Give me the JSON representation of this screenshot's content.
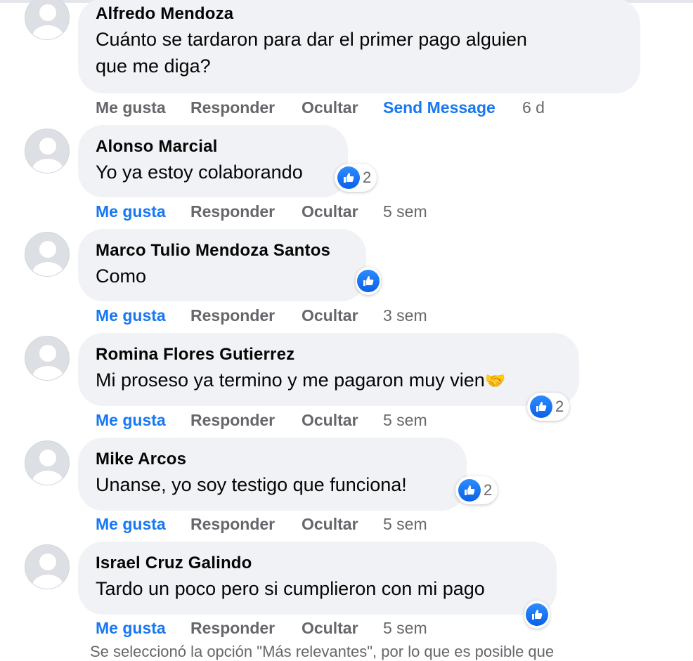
{
  "comments": [
    {
      "author": "Alfredo Mendoza",
      "text_line1": "Cuánto se tardaron para dar el primer pago alguien",
      "text_line2": "que me diga?",
      "actions": {
        "like": "Me gusta",
        "reply": "Responder",
        "hide": "Ocultar",
        "send": "Send Message",
        "time": "6 d"
      }
    },
    {
      "author": "Alonso Marcial",
      "text": "Yo ya estoy colaborando",
      "reactions": "2",
      "actions": {
        "like": "Me gusta",
        "reply": "Responder",
        "hide": "Ocultar",
        "time": "5 sem"
      }
    },
    {
      "author": "Marco Tulio Mendoza Santos",
      "text": "Como",
      "actions": {
        "like": "Me gusta",
        "reply": "Responder",
        "hide": "Ocultar",
        "time": "3 sem"
      }
    },
    {
      "author": "Romina Flores Gutierrez",
      "text": "Mi proseso ya termino y me pagaron muy vien",
      "emoji": "🤝",
      "reactions": "2",
      "actions": {
        "like": "Me gusta",
        "reply": "Responder",
        "hide": "Ocultar",
        "time": "5 sem"
      }
    },
    {
      "author": "Mike Arcos",
      "text": "Unanse, yo soy testigo que funciona!",
      "reactions": "2",
      "actions": {
        "like": "Me gusta",
        "reply": "Responder",
        "hide": "Ocultar",
        "time": "5 sem"
      }
    },
    {
      "author": "Israel Cruz Galindo",
      "text": "Tardo un poco pero si cumplieron con mi pago",
      "actions": {
        "like": "Me gusta",
        "reply": "Responder",
        "hide": "Ocultar",
        "time": "5 sem"
      }
    }
  ],
  "footer_note": "Se seleccionó la opción \"Más relevantes\", por lo que es posible que",
  "colors": {
    "accent": "#1877f2",
    "bubble": "#f0f2f5",
    "muted": "#65676b"
  },
  "icons": {
    "avatar": "default-avatar-icon",
    "reaction": "like-reaction-icon"
  }
}
